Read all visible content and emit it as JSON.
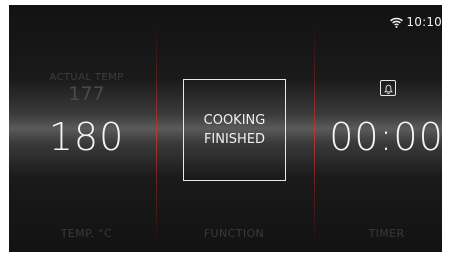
{
  "status_bar": {
    "wifi_icon": "wifi-icon",
    "time": "10:10"
  },
  "temperature": {
    "actual_label": "ACTUAL  TEMP",
    "actual_value": "177",
    "set_value": "180",
    "section_label": "TEMP. °C"
  },
  "function": {
    "status_line1": "COOKING",
    "status_line2": "FINISHED",
    "section_label": "FUNCTION"
  },
  "timer": {
    "bell_icon": "bell-icon",
    "value": "00:00",
    "section_label": "TIMER"
  }
}
